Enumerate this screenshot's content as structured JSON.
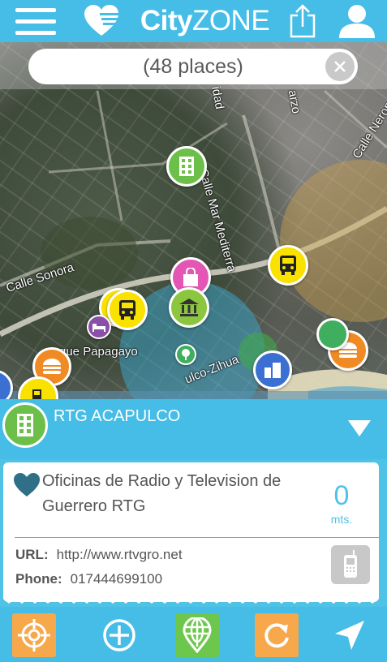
{
  "app": {
    "logo_part1": "City",
    "logo_part2": "ZONE"
  },
  "header": {
    "icons": [
      "menu-icon",
      "heart-list-icon",
      "share-icon",
      "user-icon"
    ]
  },
  "search": {
    "text": "(48 places)",
    "clear_icon": "close-icon"
  },
  "map": {
    "streets": [
      "Calle Sonora",
      "Calle Mar Mediterra",
      "Calle Neron",
      "arzo",
      "idad",
      "rque Papagayo",
      "ulco-Zihua"
    ]
  },
  "selected_place": {
    "title": "RTG ACAPULCO",
    "icon": "building-icon"
  },
  "detail": {
    "name": "Oficinas de Radio y Television de Guerrero RTG",
    "distance": "0",
    "distance_unit": "mts.",
    "url_label": "URL:",
    "url_value": "http://www.rtvgro.net",
    "phone_label": "Phone:",
    "phone_value": "017444699100"
  },
  "toolbar": {
    "icons": [
      "locate-target-icon",
      "add-icon",
      "globe-pin-icon",
      "refresh-icon",
      "navigation-arrow-icon"
    ]
  },
  "colors": {
    "brand_blue": "#45bde6",
    "accent_orange": "#f6a84a",
    "accent_green": "#6cc74c",
    "accent_yellow": "#f9e100"
  }
}
